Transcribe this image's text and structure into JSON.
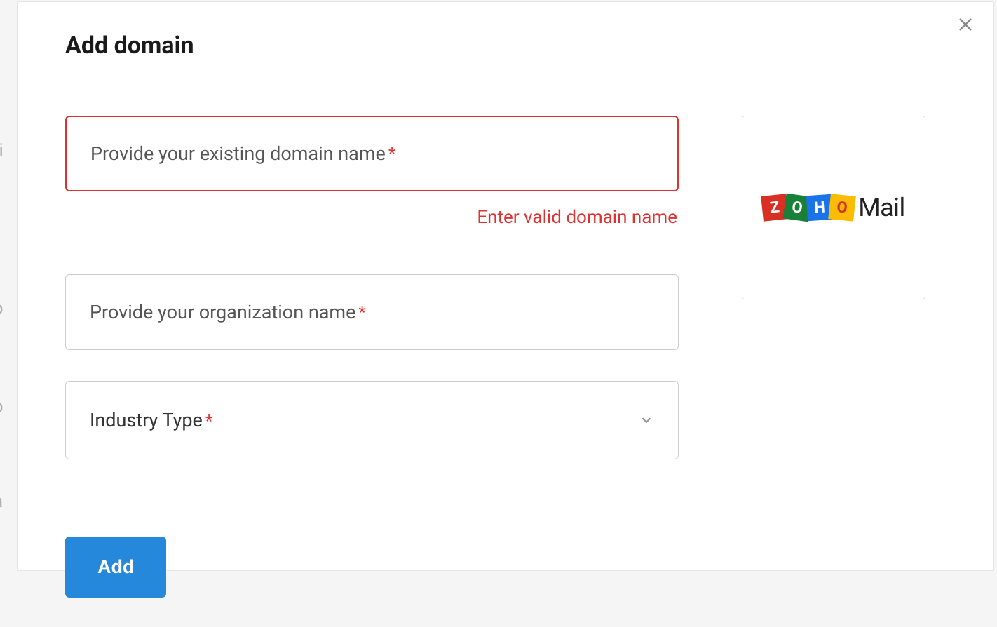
{
  "modal": {
    "title": "Add domain",
    "close_label": "Close"
  },
  "form": {
    "domain": {
      "placeholder": "Provide your existing domain name",
      "required": "*",
      "error": "Enter valid domain name"
    },
    "organization": {
      "placeholder": "Provide your organization name",
      "required": "*"
    },
    "industry": {
      "label": "Industry Type",
      "required": "*"
    },
    "submit_label": "Add"
  },
  "logo": {
    "z": "Z",
    "o1": "O",
    "h": "H",
    "o2": "O",
    "suffix": "Mail"
  }
}
